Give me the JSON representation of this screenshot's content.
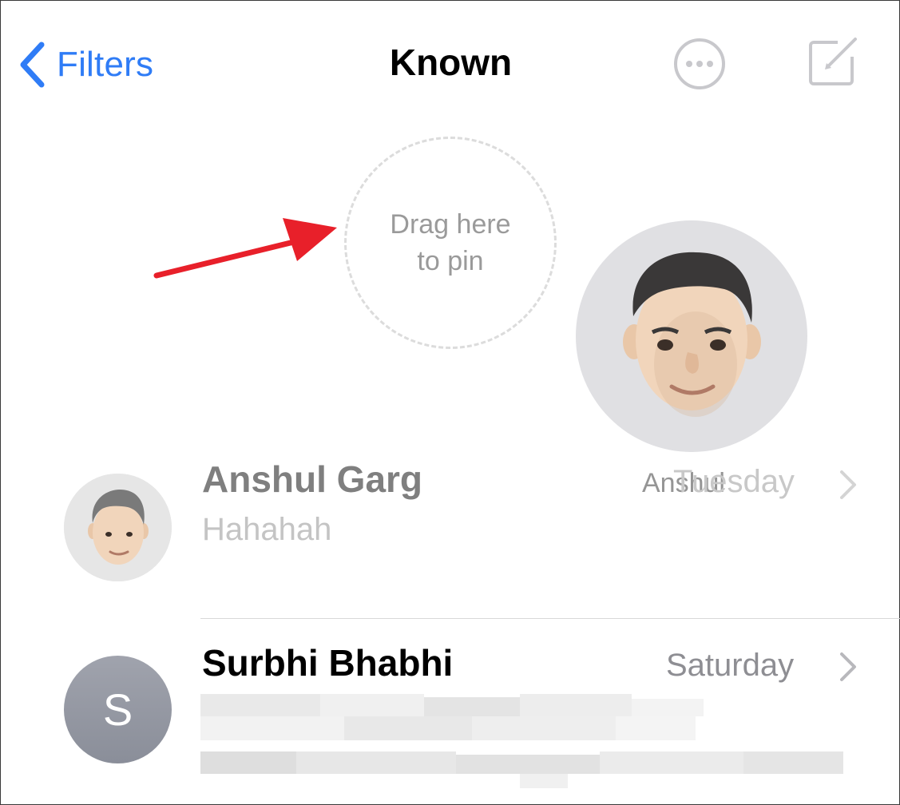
{
  "nav": {
    "back_label": "Filters",
    "title": "Known",
    "accent_color": "#2f7cf6"
  },
  "pin_zone": {
    "line1": "Drag here",
    "line2": "to pin"
  },
  "dragging": {
    "label": "Anshul"
  },
  "conversations": [
    {
      "name": "Anshul Garg",
      "preview": "Hahahah",
      "date": "Tuesday",
      "avatar": "memoji-avatar"
    },
    {
      "name": "Surbhi Bhabhi",
      "preview": "",
      "date": "Saturday",
      "avatar_initial": "S"
    }
  ],
  "icons": [
    "chevron-left-icon",
    "ellipsis-circle-icon",
    "compose-icon",
    "chevron-right-icon"
  ]
}
